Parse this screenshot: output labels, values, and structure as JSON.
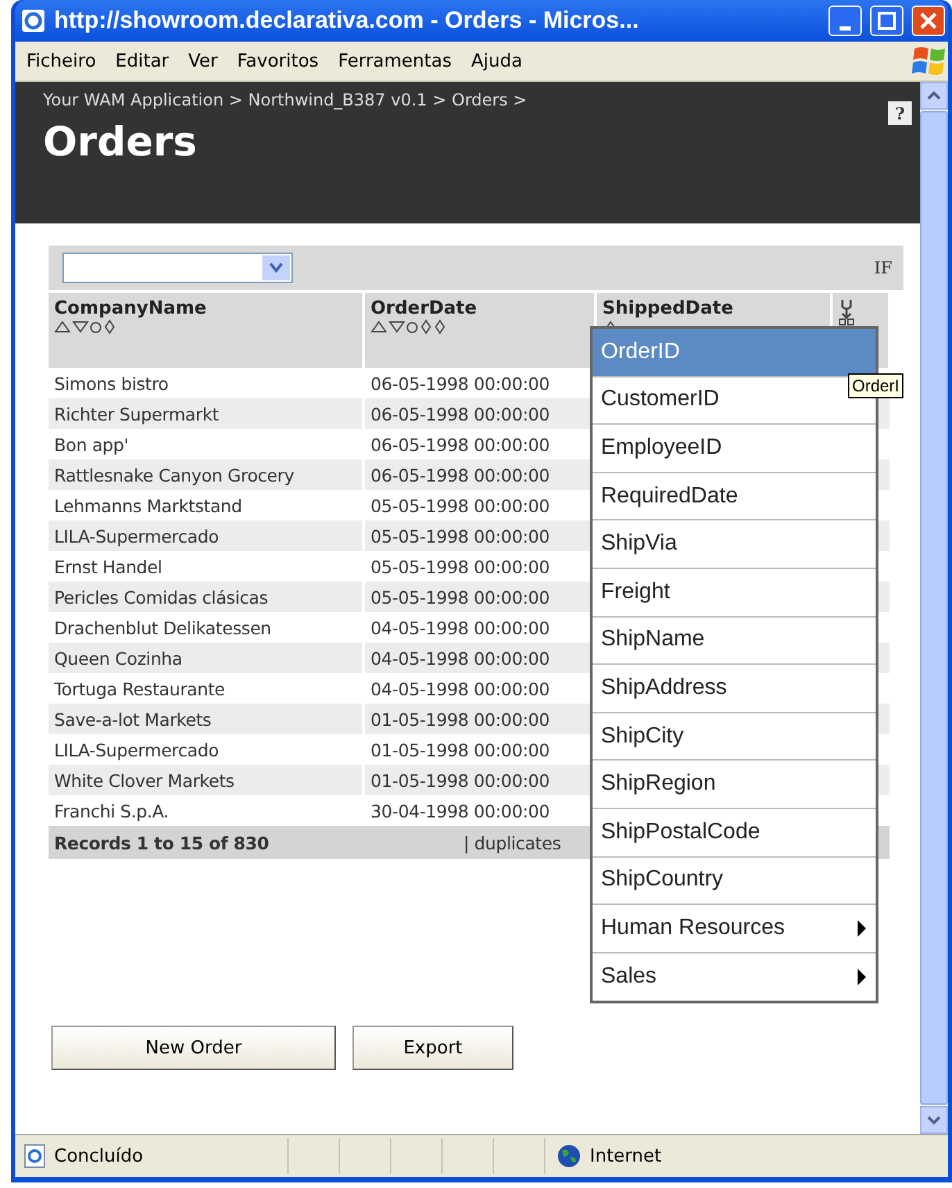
{
  "window": {
    "title": "http://showroom.declarativa.com - Orders - Micros..."
  },
  "menu_bar": [
    "Ficheiro",
    "Editar",
    "Ver",
    "Favoritos",
    "Ferramentas",
    "Ajuda"
  ],
  "header": {
    "breadcrumb": "Your WAM Application > Northwind_B387 v0.1 > Orders >",
    "title": "Orders",
    "help": "?"
  },
  "toolbar": {
    "filter_label": "IF"
  },
  "table": {
    "columns": [
      {
        "label": "CompanyName"
      },
      {
        "label": "OrderDate"
      },
      {
        "label": "ShippedDate"
      }
    ],
    "rows": [
      {
        "company": "Simons bistro",
        "order_date": "06-05-1998 00:00:00"
      },
      {
        "company": "Richter Supermarkt",
        "order_date": "06-05-1998 00:00:00"
      },
      {
        "company": "Bon app'",
        "order_date": "06-05-1998 00:00:00"
      },
      {
        "company": "Rattlesnake Canyon Grocery",
        "order_date": "06-05-1998 00:00:00"
      },
      {
        "company": "Lehmanns Marktstand",
        "order_date": "05-05-1998 00:00:00"
      },
      {
        "company": "LILA-Supermercado",
        "order_date": "05-05-1998 00:00:00"
      },
      {
        "company": "Ernst Handel",
        "order_date": "05-05-1998 00:00:00"
      },
      {
        "company": "Pericles Comidas clásicas",
        "order_date": "05-05-1998 00:00:00"
      },
      {
        "company": "Drachenblut Delikatessen",
        "order_date": "04-05-1998 00:00:00"
      },
      {
        "company": "Queen Cozinha",
        "order_date": "04-05-1998 00:00:00"
      },
      {
        "company": "Tortuga Restaurante",
        "order_date": "04-05-1998 00:00:00"
      },
      {
        "company": "Save-a-lot Markets",
        "order_date": "01-05-1998 00:00:00"
      },
      {
        "company": "LILA-Supermercado",
        "order_date": "01-05-1998 00:00:00"
      },
      {
        "company": "White Clover Markets",
        "order_date": "01-05-1998 00:00:00"
      },
      {
        "company": "Franchi S.p.A.",
        "order_date": "30-04-1998 00:00:00"
      }
    ],
    "footer": {
      "records": "Records 1 to 15 of 830",
      "duplicates": "| duplicates"
    }
  },
  "buttons": [
    "New Order",
    "Export"
  ],
  "column_menu": {
    "items": [
      {
        "label": "OrderID",
        "kind": "item",
        "selected": true
      },
      {
        "label": "CustomerID",
        "kind": "item",
        "selected": false
      },
      {
        "label": "EmployeeID",
        "kind": "item",
        "selected": false
      },
      {
        "label": "RequiredDate",
        "kind": "item",
        "selected": false
      },
      {
        "label": "ShipVia",
        "kind": "item",
        "selected": false
      },
      {
        "label": "Freight",
        "kind": "item",
        "selected": false
      },
      {
        "label": "ShipName",
        "kind": "item",
        "selected": false
      },
      {
        "label": "ShipAddress",
        "kind": "item",
        "selected": false
      },
      {
        "label": "ShipCity",
        "kind": "item",
        "selected": false
      },
      {
        "label": "ShipRegion",
        "kind": "item",
        "selected": false
      },
      {
        "label": "ShipPostalCode",
        "kind": "item",
        "selected": false
      },
      {
        "label": "ShipCountry",
        "kind": "item",
        "selected": false
      },
      {
        "label": "Human Resources",
        "kind": "submenu",
        "selected": false
      },
      {
        "label": "Sales",
        "kind": "submenu",
        "selected": false
      }
    ],
    "tooltip": "OrderI"
  },
  "status_bar": {
    "status": "Concluído",
    "zone": "Internet"
  }
}
